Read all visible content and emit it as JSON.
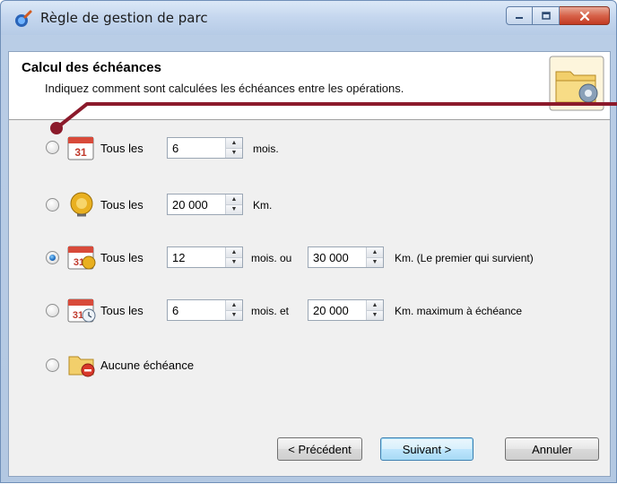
{
  "window": {
    "title": "Règle de gestion de parc"
  },
  "header": {
    "title": "Calcul des échéances",
    "subtitle": "Indiquez comment sont calculées les échéances entre les opérations."
  },
  "options": [
    {
      "icon": "calendar-icon",
      "selected": false,
      "label": "Tous les",
      "value1": "6",
      "unit1": "mois."
    },
    {
      "icon": "odometer-icon",
      "selected": false,
      "label": "Tous les",
      "value1": "20 000",
      "unit1": "Km."
    },
    {
      "icon": "calendar-odometer-icon",
      "selected": true,
      "label": "Tous les",
      "value1": "12",
      "unit1": "mois. ou",
      "value2": "30 000",
      "unit2": "Km. (Le premier qui survient)"
    },
    {
      "icon": "calendar-clock-icon",
      "selected": false,
      "label": "Tous les",
      "value1": "6",
      "unit1": "mois. et",
      "value2": "20 000",
      "unit2": "Km. maximum à échéance"
    },
    {
      "icon": "folder-no-deadline-icon",
      "selected": false,
      "label": "Aucune échéance"
    }
  ],
  "buttons": {
    "previous": "< Précédent",
    "next": "Suivant >",
    "cancel": "Annuler"
  },
  "colors": {
    "callout_line": "#8b1a2b",
    "selected_radio": "#1f6dc0",
    "default_button_border": "#3c7fb1"
  }
}
